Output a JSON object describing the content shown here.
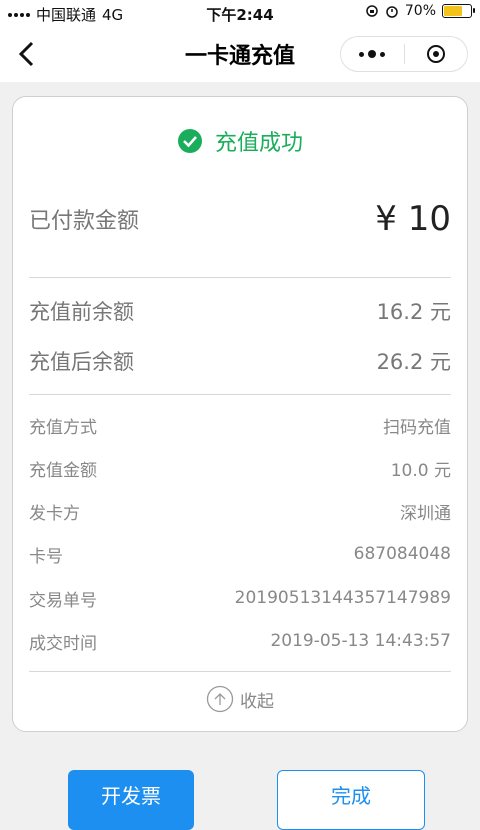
{
  "status_bar": {
    "carrier": "中国联通",
    "network": "4G",
    "time": "下午2:44",
    "battery": "70%",
    "battery_level": 0.7
  },
  "nav": {
    "title": "一卡通充值",
    "back_icon": "chevron-left-icon",
    "more_icon": "more-dots-icon",
    "close_icon": "target-icon"
  },
  "result": {
    "status": "充值成功",
    "paid_label": "已付款金额",
    "paid_amount": "¥ 10"
  },
  "balances": [
    {
      "label": "充值前余额",
      "value": "16.2 元"
    },
    {
      "label": "充值后余额",
      "value": "26.2 元"
    }
  ],
  "details": [
    {
      "label": "充值方式",
      "value": "扫码充值"
    },
    {
      "label": "充值金额",
      "value": "10.0 元"
    },
    {
      "label": "发卡方",
      "value": "深圳通"
    },
    {
      "label": "卡号",
      "value": "687084048"
    },
    {
      "label": "交易单号",
      "value": "20190513144357147989"
    },
    {
      "label": "成交时间",
      "value": "2019-05-13 14:43:57"
    }
  ],
  "collapse_label": "收起",
  "buttons": {
    "invoice": "开发票",
    "done": "完成"
  },
  "colors": {
    "success": "#1aad5b",
    "primary": "#1d8ff0"
  }
}
